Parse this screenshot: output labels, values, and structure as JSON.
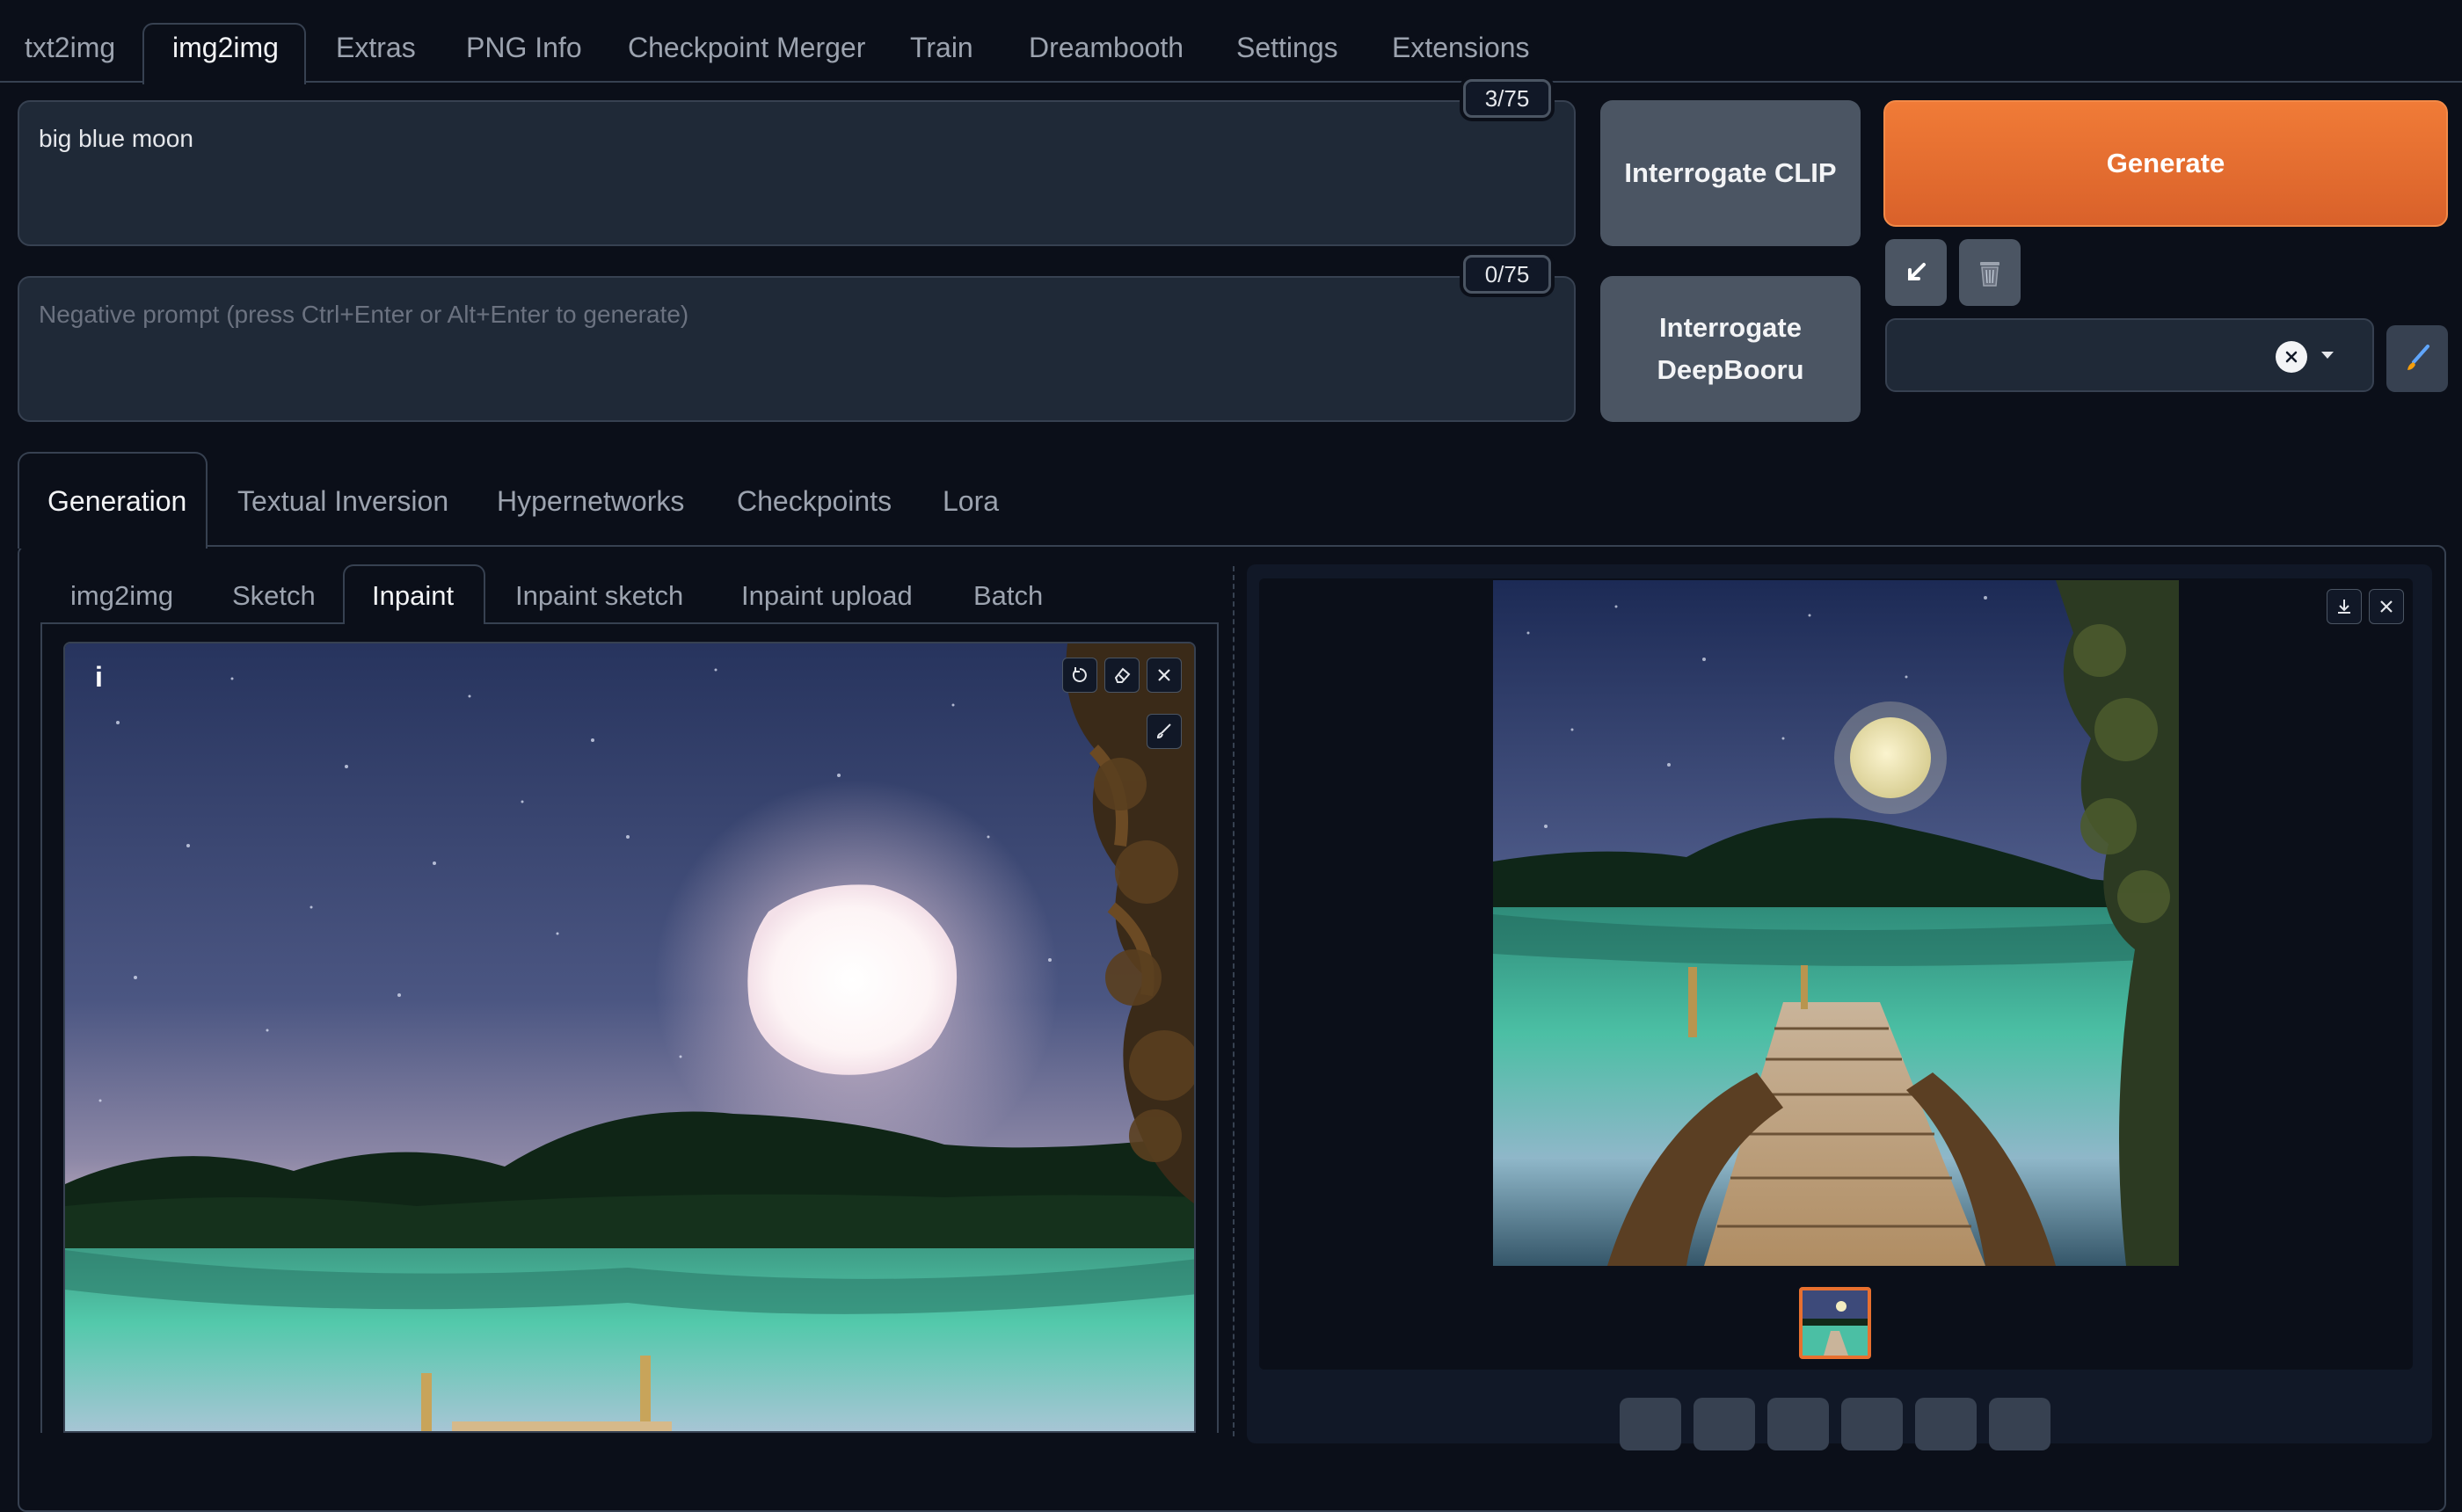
{
  "top_tabs": [
    {
      "label": "txt2img",
      "active": false
    },
    {
      "label": "img2img",
      "active": true
    },
    {
      "label": "Extras",
      "active": false
    },
    {
      "label": "PNG Info",
      "active": false
    },
    {
      "label": "Checkpoint Merger",
      "active": false
    },
    {
      "label": "Train",
      "active": false
    },
    {
      "label": "Dreambooth",
      "active": false
    },
    {
      "label": "Settings",
      "active": false
    },
    {
      "label": "Extensions",
      "active": false
    }
  ],
  "prompt": {
    "value": "big blue moon",
    "counter": "3/75"
  },
  "negative_prompt": {
    "placeholder": "Negative prompt (press Ctrl+Enter or Alt+Enter to generate)",
    "counter": "0/75"
  },
  "buttons": {
    "interrogate_clip": "Interrogate CLIP",
    "interrogate_deepbooru_line1": "Interrogate",
    "interrogate_deepbooru_line2": "DeepBooru",
    "generate": "Generate"
  },
  "section_tabs": [
    {
      "label": "Generation",
      "active": true
    },
    {
      "label": "Textual Inversion",
      "active": false
    },
    {
      "label": "Hypernetworks",
      "active": false
    },
    {
      "label": "Checkpoints",
      "active": false
    },
    {
      "label": "Lora",
      "active": false
    }
  ],
  "mode_tabs": [
    {
      "label": "img2img",
      "active": false
    },
    {
      "label": "Sketch",
      "active": false
    },
    {
      "label": "Inpaint",
      "active": true
    },
    {
      "label": "Inpaint sketch",
      "active": false
    },
    {
      "label": "Inpaint upload",
      "active": false
    },
    {
      "label": "Batch",
      "active": false
    }
  ],
  "canvas": {
    "info_label": "i"
  },
  "colors": {
    "accent": "#e8702f",
    "background": "#0b0f19",
    "panel": "#1f2937",
    "border": "#374151"
  },
  "icons": {
    "undo": "undo-icon",
    "eraser": "eraser-icon",
    "close": "close-icon",
    "brush": "brush-icon",
    "download": "download-icon",
    "arrow": "arrow-down-left-icon",
    "trash": "trash-icon",
    "paint": "paintbrush-icon"
  }
}
